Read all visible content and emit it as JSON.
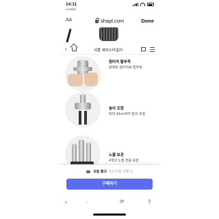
{
  "status_bar": {
    "time": "14:11",
    "back_label": "◂ Safari"
  },
  "url_bar": {
    "text_size_label": "AA",
    "url": "shapl.com",
    "done_label": "Done"
  },
  "site_nav": {
    "brand": "샤플 헤어스타일러"
  },
  "features": [
    {
      "title": "원터치 탈부착",
      "description": "본체와 원터치로 탈부착"
    },
    {
      "title": "높이 조정",
      "description": "최대 30cm까지 높이 조정"
    },
    {
      "title": "노즐 보관",
      "description": "4개의 노즐 전용 보관"
    }
  ],
  "sheet": {
    "shipping_title": "오늘 출고",
    "shipping_sub": "3시 이전 구매 시",
    "buy_label": "구매하기"
  },
  "colors": {
    "buy_button": "#5a6cf0",
    "page_bg": "#ffffff"
  },
  "icons": [
    "signal-icon",
    "wifi-icon",
    "battery-icon",
    "lock-icon",
    "back-icon",
    "home-icon",
    "bag-icon",
    "menu-icon",
    "truck-icon",
    "browser-back-icon",
    "browser-forward-icon",
    "reload-icon",
    "share-icon"
  ]
}
